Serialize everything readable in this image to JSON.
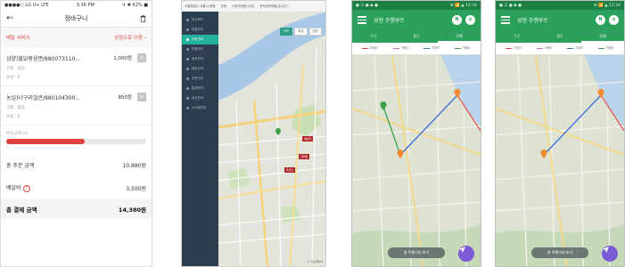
{
  "cart": {
    "status": {
      "carrier": "●●●●○ LG U+  LTE",
      "time": "3:36 PM",
      "battery": "✈ ✱ 62% ■"
    },
    "title": "장바구니",
    "service": {
      "label": "배달 서비스",
      "link": "상점으로 이동 ›"
    },
    "items": [
      {
        "name": "삼양)불닭볶음면/880073110...",
        "price": "1,000원",
        "option": "선택 : 없음",
        "qty": "수량 : 5"
      },
      {
        "name": "농심)너구리얼큰/880104300...",
        "price": "850원",
        "option": "선택 : 없음",
        "qty": "수량 : 6"
      }
    ],
    "progress": {
      "label": "배달금액(%)",
      "value": 0.56,
      "color": "#e0413f",
      "ticks": [
        "0",
        "",
        "",
        "",
        "",
        "",
        ""
      ]
    },
    "order_total": {
      "label": "총 주문 금액",
      "value": "10,880원"
    },
    "delivery_fee": {
      "label": "배달비",
      "value": "3,500원"
    },
    "grand_total": {
      "label": "총 결제 금액",
      "value": "14,380원"
    }
  },
  "web": {
    "top_tabs": [
      "서울특별시 서울시 종합",
      "관제",
      "사업자현황(사업)",
      "위치정보현황(실시간)"
    ],
    "sidebar": [
      "대시보드",
      "현황관리",
      "차량관리",
      "운행관리",
      "위치관리",
      "배송관리",
      "주문관리",
      "통계관리",
      "정산관리",
      "시스템관리"
    ],
    "active_index": 2,
    "map_controls": [
      "지도",
      "위성",
      "일반"
    ],
    "markers": [
      "배송지",
      "판매점",
      "주유소"
    ],
    "footer": "© 지도데이터"
  },
  "apps": [
    {
      "status": {
        "left": "● ☰ ● ◆ ●",
        "right": "⊕ 📶 ▲ 12:34"
      },
      "title": "성현 주행루트",
      "buttons": [
        "N",
        "⊙"
      ],
      "tabs": [
        "주간",
        "월간",
        "전체"
      ],
      "active_tab": 2,
      "legend": [
        {
          "label": "차량1",
          "color": "#e0413f"
        },
        {
          "label": "차량2",
          "color": "#c06ad6"
        },
        {
          "label": "차량3",
          "color": "#3b6ddb"
        },
        {
          "label": "차량4",
          "color": "#3aa04a"
        }
      ],
      "pill": "총 주행거리 보기",
      "fab_icon": "navigation-icon"
    },
    {
      "status": {
        "left": "● ☰ ● ◆ ●",
        "right": "⊕ 📶 ▲ 12:34"
      },
      "title": "성현 주행루트",
      "buttons": [
        "N",
        "⊙"
      ],
      "tabs": [
        "주간",
        "월간",
        "전체"
      ],
      "active_tab": 2,
      "legend": [
        {
          "label": "차량1",
          "color": "#e0413f"
        },
        {
          "label": "차량2",
          "color": "#c06ad6"
        },
        {
          "label": "차량3",
          "color": "#3b6ddb"
        },
        {
          "label": "차량4",
          "color": "#3aa04a"
        }
      ],
      "pill": "총 주행거리 보기",
      "fab_icon": "navigation-icon"
    }
  ]
}
